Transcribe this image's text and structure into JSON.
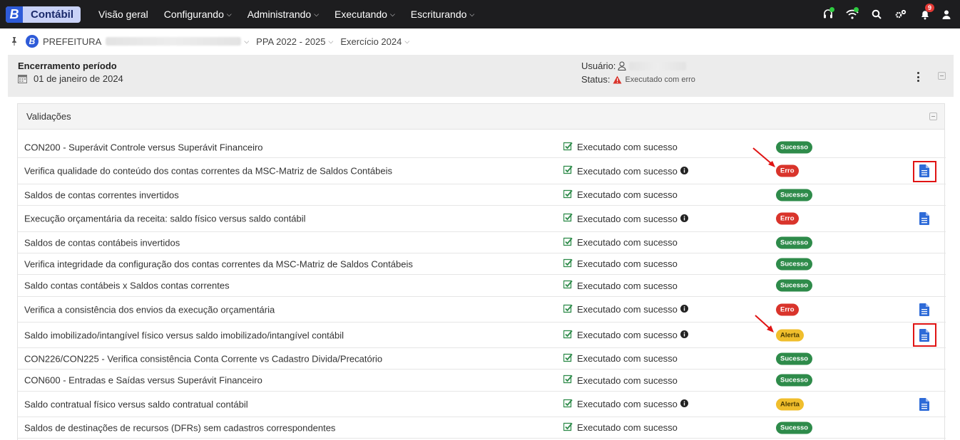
{
  "navbar": {
    "logo_letter": "B",
    "app_name": "Contábil",
    "menu": [
      {
        "label": "Visão geral",
        "has_dropdown": false
      },
      {
        "label": "Configurando",
        "has_dropdown": true
      },
      {
        "label": "Administrando",
        "has_dropdown": true
      },
      {
        "label": "Executando",
        "has_dropdown": true
      },
      {
        "label": "Escriturando",
        "has_dropdown": true
      }
    ],
    "notification_count": "9",
    "icons": [
      "headset-icon",
      "wifi-icon",
      "search-icon",
      "settings-icon",
      "bell-icon",
      "user-icon"
    ]
  },
  "breadcrumb": {
    "logo_letter": "B",
    "entity": "PREFEITURA",
    "ppa": "PPA 2022 - 2025",
    "exercicio": "Exercício 2024"
  },
  "header": {
    "title": "Encerramento período",
    "date": "01 de janeiro de 2024",
    "user_label": "Usuário:",
    "status_label": "Status:",
    "status_text": "Executado com erro"
  },
  "validations": {
    "title": "Validações",
    "rows": [
      {
        "name": "CON200 - Superávit Controle versus Superávit Financeiro",
        "exec": "Executado com sucesso",
        "info": false,
        "badge": "Sucesso",
        "type": "sucesso",
        "doc": false
      },
      {
        "name": "Verifica qualidade do conteúdo dos contas correntes da MSC-Matriz de Saldos Contábeis",
        "exec": "Executado com sucesso",
        "info": true,
        "badge": "Erro",
        "type": "erro",
        "doc": true
      },
      {
        "name": "Saldos de contas correntes invertidos",
        "exec": "Executado com sucesso",
        "info": false,
        "badge": "Sucesso",
        "type": "sucesso",
        "doc": false
      },
      {
        "name": "Execução orçamentária da receita: saldo físico versus saldo contábil",
        "exec": "Executado com sucesso",
        "info": true,
        "badge": "Erro",
        "type": "erro",
        "doc": true
      },
      {
        "name": "Saldos de contas contábeis invertidos",
        "exec": "Executado com sucesso",
        "info": false,
        "badge": "Sucesso",
        "type": "sucesso",
        "doc": false
      },
      {
        "name": "Verifica integridade da configuração dos contas correntes da MSC-Matriz de Saldos Contábeis",
        "exec": "Executado com sucesso",
        "info": false,
        "badge": "Sucesso",
        "type": "sucesso",
        "doc": false
      },
      {
        "name": "Saldo contas contábeis x Saldos contas correntes",
        "exec": "Executado com sucesso",
        "info": false,
        "badge": "Sucesso",
        "type": "sucesso",
        "doc": false
      },
      {
        "name": "Verifica a consistência dos envios da execução orçamentária",
        "exec": "Executado com sucesso",
        "info": true,
        "badge": "Erro",
        "type": "erro",
        "doc": true
      },
      {
        "name": "Saldo imobilizado/intangível físico versus saldo imobilizado/intangível contábil",
        "exec": "Executado com sucesso",
        "info": true,
        "badge": "Alerta",
        "type": "alerta",
        "doc": true
      },
      {
        "name": "CON226/CON225 - Verifica consistência Conta Corrente vs Cadastro Divida/Precatório",
        "exec": "Executado com sucesso",
        "info": false,
        "badge": "Sucesso",
        "type": "sucesso",
        "doc": false
      },
      {
        "name": "CON600 - Entradas e Saídas versus Superávit Financeiro",
        "exec": "Executado com sucesso",
        "info": false,
        "badge": "Sucesso",
        "type": "sucesso",
        "doc": false
      },
      {
        "name": "Saldo contratual físico versus saldo contratual contábil",
        "exec": "Executado com sucesso",
        "info": true,
        "badge": "Alerta",
        "type": "alerta",
        "doc": true
      },
      {
        "name": "Saldos de destinações de recursos (DFRs) sem cadastros correspondentes",
        "exec": "Executado com sucesso",
        "info": false,
        "badge": "Sucesso",
        "type": "sucesso",
        "doc": false
      }
    ]
  },
  "colors": {
    "navbar_bg": "#1d1d1f",
    "brand_blue": "#2e5bd8",
    "success": "#2e8b4a",
    "error": "#d9342b",
    "alert": "#f0be2c",
    "highlight_red": "#e01414"
  }
}
